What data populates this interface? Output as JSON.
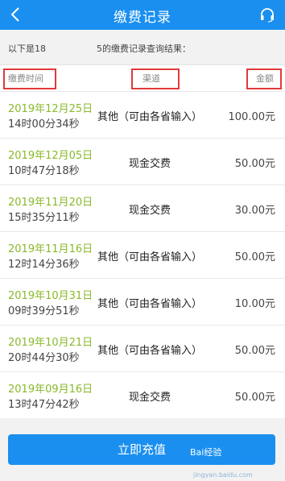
{
  "header": {
    "title": "缴费记录",
    "back_icon": "chevron-left-icon",
    "support_icon": "headset-icon",
    "color": "#1a8ff0"
  },
  "subtitle": {
    "prefix": "以下是18",
    "suffix": "5的缴费记录查询结果："
  },
  "columns": {
    "time": "缴费时间",
    "channel": "渠道",
    "amount": "金额"
  },
  "records": [
    {
      "date": "2019年12月25日",
      "time": "14时00分34秒",
      "channel": "其他（可由各省输入）",
      "amount": "100.00元"
    },
    {
      "date": "2019年12月05日",
      "time": "10时47分18秒",
      "channel": "现金交费",
      "amount": "50.00元"
    },
    {
      "date": "2019年11月20日",
      "time": "15时35分11秒",
      "channel": "现金交费",
      "amount": "30.00元"
    },
    {
      "date": "2019年11月16日",
      "time": "12时14分36秒",
      "channel": "其他（可由各省输入）",
      "amount": "50.00元"
    },
    {
      "date": "2019年10月31日",
      "time": "09时39分51秒",
      "channel": "其他（可由各省输入）",
      "amount": "10.00元"
    },
    {
      "date": "2019年10月21日",
      "time": "20时44分30秒",
      "channel": "其他（可由各省输入）",
      "amount": "50.00元"
    },
    {
      "date": "2019年09月16日",
      "time": "13时47分42秒",
      "channel": "现金交费",
      "amount": "50.00元"
    }
  ],
  "button": {
    "label": "立即充值"
  },
  "watermark": {
    "text": "Bai经验",
    "sub": "jingyan.baidu.com"
  }
}
